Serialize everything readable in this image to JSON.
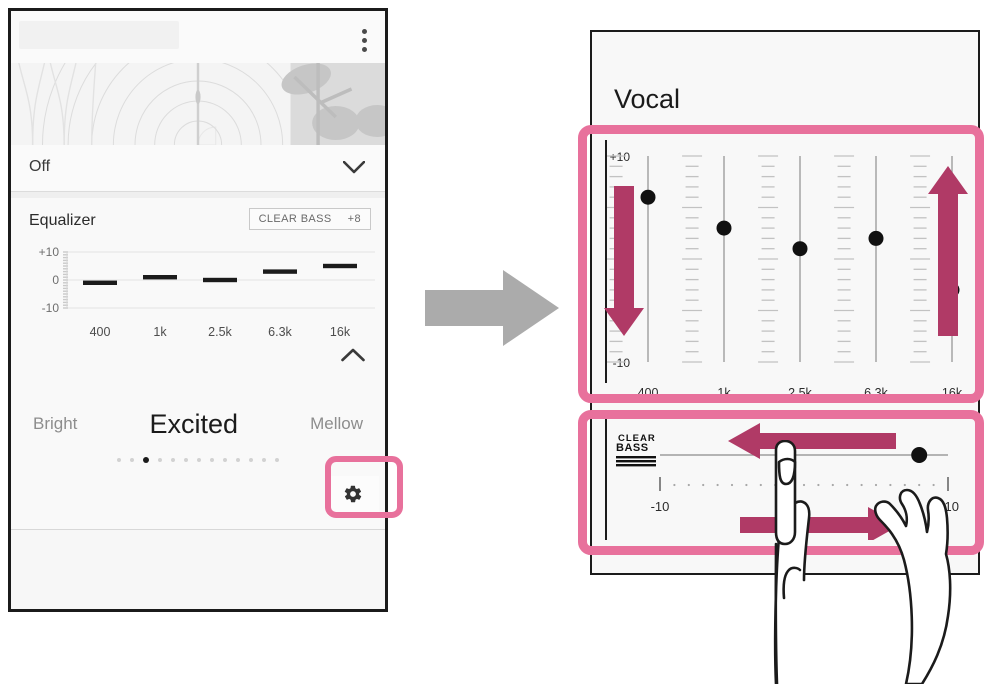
{
  "left_panel": {
    "menu_icon": "kebab-menu-icon",
    "sound_effect_row": {
      "value": "Off",
      "chevron": "chevron-down-icon"
    },
    "equalizer_card": {
      "title": "Equalizer",
      "clear_bass_badge": {
        "label": "CLEAR BASS",
        "value": "+8"
      },
      "collapse_chevron": "chevron-up-icon"
    },
    "preset_carousel": {
      "left_label": "Bright",
      "current_label": "Excited",
      "right_label": "Mellow",
      "dot_count": 13,
      "active_dot_index": 2
    },
    "settings_button": {
      "icon": "gear-icon",
      "highlighted": true
    }
  },
  "flow_arrow": {
    "icon": "right-arrow-icon",
    "color": "#ababab"
  },
  "right_panel": {
    "title": "Vocal",
    "eq_section": {
      "highlighted": true,
      "down_arrow": "down-arrow-icon",
      "up_arrow": "up-arrow-icon"
    },
    "clear_bass_section": {
      "highlighted": true,
      "logo_line1": "CLEAR",
      "logo_line2": "BASS",
      "min_label": "-10",
      "max_label": "+10",
      "left_arrow": "left-arrow-icon",
      "right_arrow": "right-arrow-icon",
      "hand": "hand-pointing-icon"
    }
  },
  "colors": {
    "highlight_pink": "#e8719c",
    "arrow_magenta": "#b03a66",
    "gray_arrow": "#ababab",
    "ink": "#1b1b1b"
  },
  "chart_data": [
    {
      "type": "bar",
      "name": "mini-equalizer-preview",
      "title": "Equalizer",
      "categories": [
        "400",
        "1k",
        "2.5k",
        "6.3k",
        "16k"
      ],
      "values": [
        -1,
        1,
        0,
        3,
        5
      ],
      "ylim": [
        -10,
        10
      ],
      "ytick_labels": [
        "+10",
        "0",
        "-10"
      ],
      "ytick_values": [
        10,
        0,
        -10
      ],
      "xlabel": "",
      "ylabel": "",
      "grid": true
    },
    {
      "type": "bar",
      "name": "vocal-equalizer-sliders",
      "title": "Vocal",
      "categories": [
        "400",
        "1k",
        "2.5k",
        "6.3k",
        "16k"
      ],
      "values": [
        6,
        3,
        1,
        2,
        -3
      ],
      "ylim": [
        -10,
        10
      ],
      "ytick_labels": [
        "+10",
        "-10"
      ],
      "ytick_values": [
        10,
        -10
      ],
      "xlabel": "",
      "ylabel": "",
      "grid": false
    },
    {
      "type": "bar",
      "name": "clear-bass-slider",
      "title": "CLEAR BASS",
      "categories": [
        "Clear Bass"
      ],
      "values": [
        8
      ],
      "ylim": [
        -10,
        10
      ],
      "ytick_labels": [
        "-10",
        "+10"
      ],
      "ytick_values": [
        -10,
        10
      ],
      "xlabel": "",
      "ylabel": "",
      "grid": false
    }
  ]
}
